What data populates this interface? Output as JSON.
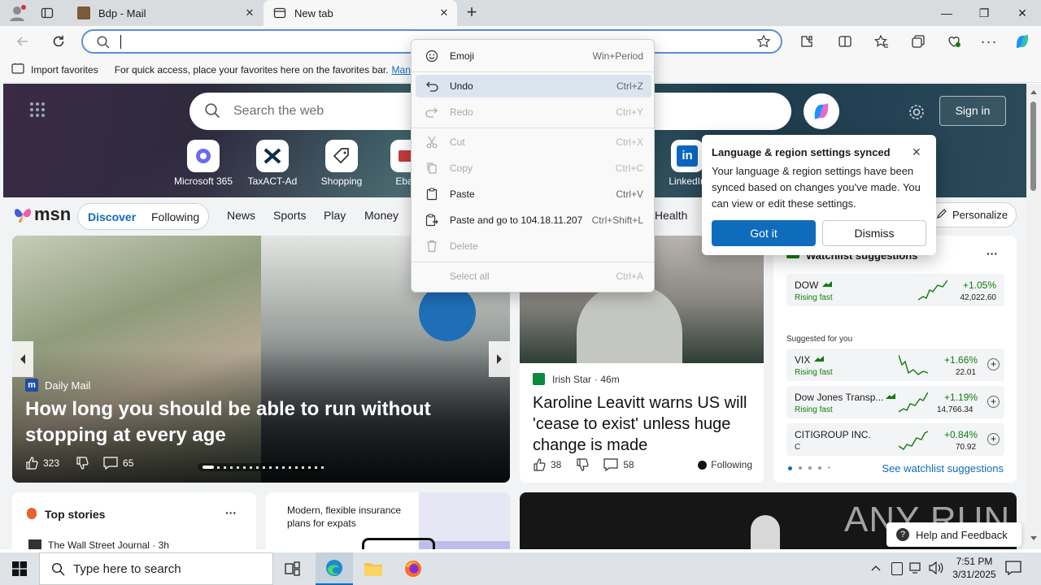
{
  "tabs": [
    {
      "title": "Bdp - Mail",
      "close": "✕"
    },
    {
      "title": "New tab",
      "close": "✕"
    }
  ],
  "new_tab_button": "+",
  "window_controls": {
    "minimize": "—",
    "maximize": "❐",
    "close": "✕"
  },
  "address": {
    "value": "",
    "placeholder": ""
  },
  "favbar": {
    "import_label": "Import favorites",
    "hint": "For quick access, place your favorites here on the favorites bar.",
    "manage_link": "Mana"
  },
  "newtab": {
    "search_placeholder": "Search the web",
    "sign_in": "Sign in",
    "quick_links": [
      {
        "label": "Microsoft 365"
      },
      {
        "label": "TaxACT-Ad"
      },
      {
        "label": "Shopping"
      },
      {
        "label": "Ebay"
      },
      {
        "label": "LinkedIn"
      }
    ]
  },
  "msn": {
    "logo": "msn",
    "pills": [
      "Discover",
      "Following"
    ],
    "nav": [
      "News",
      "Sports",
      "Play",
      "Money",
      "Health"
    ],
    "personalize": "Personalize"
  },
  "hero": {
    "source": "Daily Mail",
    "headline": "How long you should be able to run without stopping at every age",
    "likes": "323",
    "comments": "65"
  },
  "story2": {
    "source": "Irish Star",
    "age": "· 46m",
    "headline": "Karoline Leavitt warns US will 'cease to exist' unless huge change is made",
    "likes": "38",
    "comments": "58",
    "following": "Following"
  },
  "watchlist": {
    "title": "Watchlist suggestions",
    "more": "···",
    "suggested_label": "Suggested for you",
    "see_more": "See watchlist suggestions",
    "items": [
      {
        "name": "DOW",
        "status": "Rising fast",
        "change": "+1.05%",
        "price": "42,022.60"
      },
      {
        "name": "VIX",
        "status": "Rising fast",
        "change": "+1.66%",
        "price": "22.01"
      },
      {
        "name": "Dow Jones Transp...",
        "status": "Rising fast",
        "change": "+1.19%",
        "price": "14,766.34"
      },
      {
        "name": "CITIGROUP INC.",
        "status": "C",
        "change": "+0.84%",
        "price": "70.92"
      }
    ]
  },
  "topstories": {
    "title": "Top stories",
    "more": "···",
    "first_source": "The Wall Street Journal · 3h"
  },
  "ad": {
    "text": "Modern, flexible insurance plans for expats"
  },
  "help_feedback": "Help and Feedback",
  "watermark": "ANY RUN",
  "context_menu": [
    {
      "label": "Emoji",
      "shortcut": "Win+Period",
      "disabled": false
    },
    {
      "label": "Undo",
      "shortcut": "Ctrl+Z",
      "disabled": false
    },
    {
      "label": "Redo",
      "shortcut": "Ctrl+Y",
      "disabled": true
    },
    {
      "label": "Cut",
      "shortcut": "Ctrl+X",
      "disabled": true
    },
    {
      "label": "Copy",
      "shortcut": "Ctrl+C",
      "disabled": true
    },
    {
      "label": "Paste",
      "shortcut": "Ctrl+V",
      "disabled": false
    },
    {
      "label": "Paste and go to 104.18.11.207",
      "shortcut": "Ctrl+Shift+L",
      "disabled": false
    },
    {
      "label": "Delete",
      "shortcut": "",
      "disabled": true
    },
    {
      "label": "Select all",
      "shortcut": "Ctrl+A",
      "disabled": true
    }
  ],
  "sync_popup": {
    "title": "Language & region settings synced",
    "body": "Your language & region settings have been synced based on changes you've made. You can view or edit these settings.",
    "primary": "Got it",
    "secondary": "Dismiss"
  },
  "taskbar": {
    "search_placeholder": "Type here to search",
    "time": "7:51 PM",
    "date": "3/31/2025"
  },
  "colors": {
    "accent": "#0f6cbd",
    "msn_blue": "#0f6cbd",
    "rising": "#107c10"
  }
}
